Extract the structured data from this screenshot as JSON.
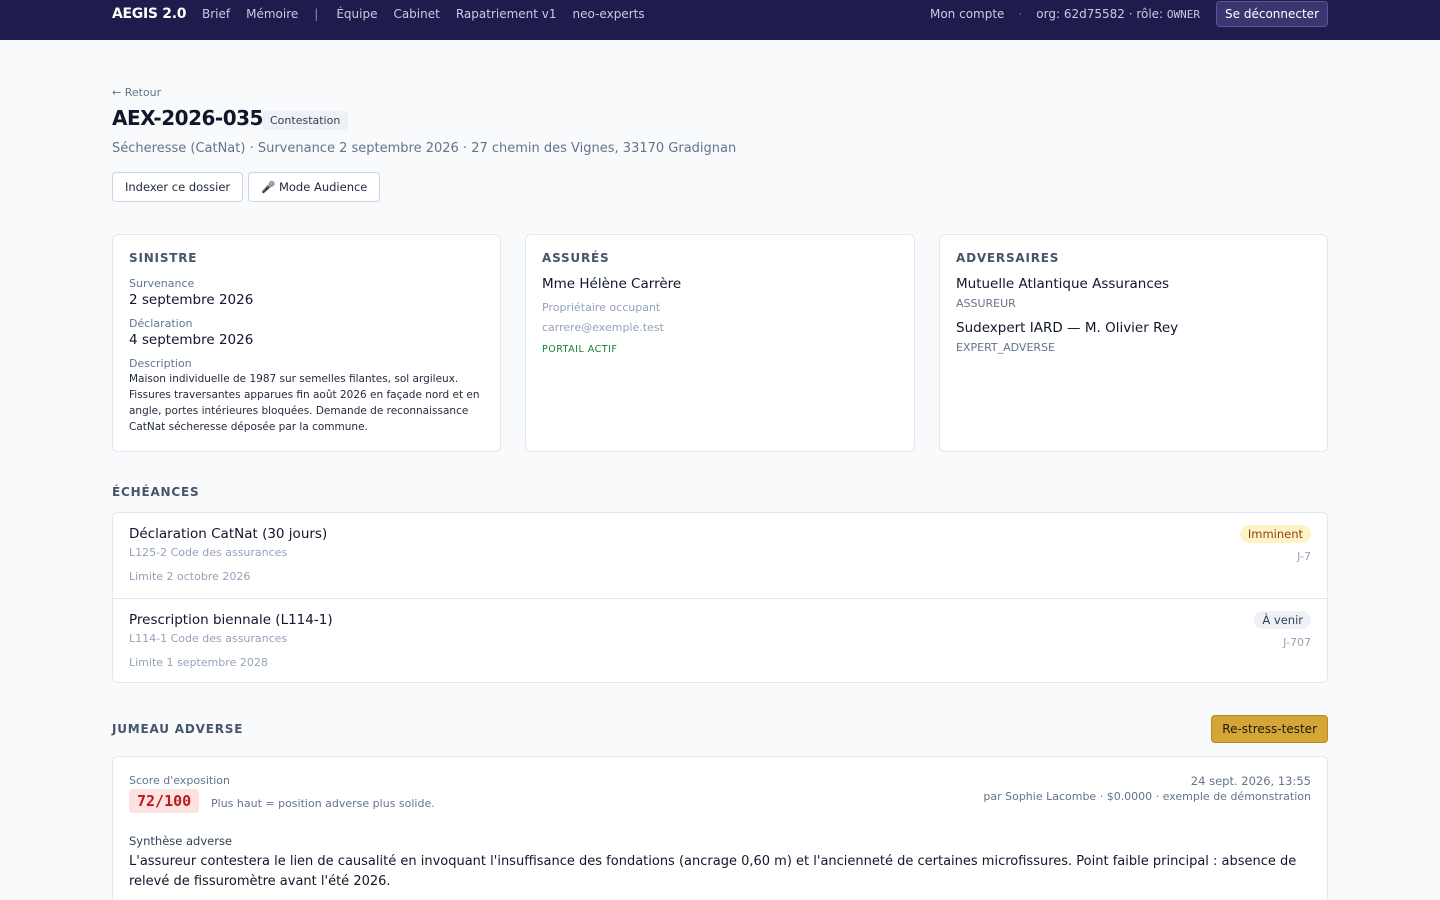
{
  "nav": {
    "brand": "AEGIS 2.0",
    "links": [
      "Brief",
      "Mémoire",
      "Équipe",
      "Cabinet",
      "Rapatriement v1",
      "neo-experts"
    ],
    "separator": "|",
    "account": "Mon compte",
    "dot": "·",
    "org_prefix": "org: ",
    "org_id": "62d75582",
    "role_prefix": " · rôle: ",
    "role": "OWNER",
    "logout": "Se déconnecter"
  },
  "header": {
    "back": "← Retour",
    "case_id": "AEX-2026-035",
    "status": "Contestation",
    "subtitle": "Sécheresse (CatNat) · Survenance 2 septembre 2026 · 27 chemin des Vignes, 33170 Gradignan",
    "actions": {
      "index": "Indexer ce dossier",
      "audience": "🎤 Mode Audience"
    }
  },
  "sinistre": {
    "heading": "SINISTRE",
    "survenance_label": "Survenance",
    "survenance": "2 septembre 2026",
    "declaration_label": "Déclaration",
    "declaration": "4 septembre 2026",
    "description_label": "Description",
    "description": "Maison individuelle de 1987 sur semelles filantes, sol argileux. Fissures traversantes apparues fin août 2026 en façade nord et en angle, portes intérieures bloquées. Demande de reconnaissance CatNat sécheresse déposée par la commune."
  },
  "assures": {
    "heading": "ASSURÉS",
    "name": "Mme Hélène Carrère",
    "role": "Propriétaire occupant",
    "email": "carrere@exemple.test",
    "portal": "PORTAIL ACTIF"
  },
  "adversaires": {
    "heading": "ADVERSAIRES",
    "items": [
      {
        "name": "Mutuelle Atlantique Assurances",
        "type": "ASSUREUR"
      },
      {
        "name": "Sudexpert IARD — M. Olivier Rey",
        "type": "EXPERT_ADVERSE"
      }
    ]
  },
  "echeances": {
    "heading": "ÉCHÉANCES",
    "items": [
      {
        "title": "Déclaration CatNat (30 jours)",
        "ref": "L125-2 Code des assurances",
        "limit": "Limite 2 octobre 2026",
        "badge": "Imminent",
        "countdown": "J-7"
      },
      {
        "title": "Prescription biennale (L114-1)",
        "ref": "L114-1 Code des assurances",
        "limit": "Limite 1 septembre 2028",
        "badge": "À venir",
        "countdown": "J-707"
      }
    ]
  },
  "jumeau": {
    "heading": "JUMEAU ADVERSE",
    "retest": "Re-stress-tester",
    "score_label": "Score d'exposition",
    "score": "72/100",
    "score_hint": "Plus haut = position adverse plus solide.",
    "date": "24 sept. 2026, 13:55",
    "meta": "par Sophie Lacombe · $0.0000 · exemple de démonstration",
    "synthese_label": "Synthèse adverse",
    "synthese": "L'assureur contestera le lien de causalité en invoquant l'insuffisance des fondations (ancrage 0,60 m) et l'ancienneté de certaines microfissures. Point faible principal : absence de relevé de fissuromètre avant l'été 2026."
  },
  "colors": {
    "topbar": "#1f1b4d",
    "accent_gold": "#d4a537",
    "score_red": "#b91c1c",
    "portal_green": "#15803d"
  }
}
